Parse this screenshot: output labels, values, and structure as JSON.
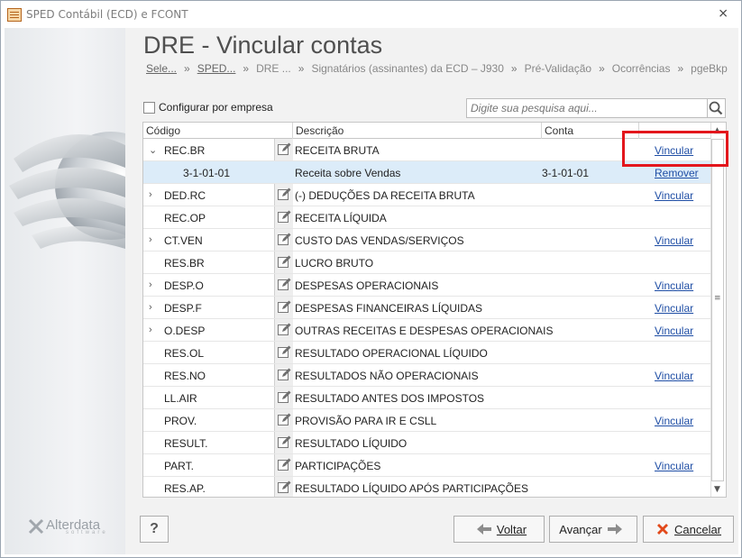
{
  "window": {
    "title": "SPED Contábil (ECD) e FCONT",
    "close_glyph": "⨯"
  },
  "page": {
    "title": "DRE - Vincular contas"
  },
  "breadcrumb": [
    {
      "label": "Sele...",
      "underline": true
    },
    {
      "label": "SPED...",
      "underline": true
    },
    {
      "label": "DRE ...",
      "underline": false
    },
    {
      "label": "Signatários (assinantes) da ECD – J930",
      "underline": false
    },
    {
      "label": "Pré-Validação",
      "underline": false
    },
    {
      "label": "Ocorrências",
      "underline": false
    },
    {
      "label": "pgeBkp",
      "underline": false
    }
  ],
  "breadcrumb_separator": "»",
  "config": {
    "checkbox_label": "Configurar por empresa",
    "checked": false
  },
  "search": {
    "placeholder": "Digite sua pesquisa aqui..."
  },
  "grid": {
    "headers": {
      "codigo": "Código",
      "descricao": "Descrição",
      "conta": "Conta"
    },
    "rows": [
      {
        "expander": "⌄",
        "code": "REC.BR",
        "desc": "RECEITA BRUTA",
        "conta": "",
        "action": "Vincular",
        "type": "parent-expanded"
      },
      {
        "expander": "",
        "code": "3-1-01-01",
        "desc": "Receita sobre Vendas",
        "conta": "3-1-01-01",
        "action": "Remover",
        "type": "child"
      },
      {
        "expander": "›",
        "code": "DED.RC",
        "desc": "(-) DEDUÇÕES DA RECEITA BRUTA",
        "conta": "",
        "action": "Vincular",
        "type": "parent"
      },
      {
        "expander": "",
        "code": "REC.OP",
        "desc": "RECEITA LÍQUIDA",
        "conta": "",
        "action": "",
        "type": "leaf"
      },
      {
        "expander": "›",
        "code": "CT.VEN",
        "desc": "CUSTO DAS VENDAS/SERVIÇOS",
        "conta": "",
        "action": "Vincular",
        "type": "parent"
      },
      {
        "expander": "",
        "code": "RES.BR",
        "desc": "LUCRO BRUTO",
        "conta": "",
        "action": "",
        "type": "leaf"
      },
      {
        "expander": "›",
        "code": "DESP.O",
        "desc": "DESPESAS OPERACIONAIS",
        "conta": "",
        "action": "Vincular",
        "type": "parent"
      },
      {
        "expander": "›",
        "code": "DESP.F",
        "desc": "DESPESAS FINANCEIRAS LÍQUIDAS",
        "conta": "",
        "action": "Vincular",
        "type": "parent"
      },
      {
        "expander": "›",
        "code": "O.DESP",
        "desc": "OUTRAS RECEITAS E DESPESAS OPERACIONAIS",
        "conta": "",
        "action": "Vincular",
        "type": "parent"
      },
      {
        "expander": "",
        "code": "RES.OL",
        "desc": "RESULTADO OPERACIONAL LÍQUIDO",
        "conta": "",
        "action": "",
        "type": "leaf"
      },
      {
        "expander": "",
        "code": "RES.NO",
        "desc": "RESULTADOS NÃO OPERACIONAIS",
        "conta": "",
        "action": "Vincular",
        "type": "leaf"
      },
      {
        "expander": "",
        "code": "LL.AIR",
        "desc": "RESULTADO ANTES DOS IMPOSTOS",
        "conta": "",
        "action": "",
        "type": "leaf"
      },
      {
        "expander": "",
        "code": "PROV.",
        "desc": "PROVISÃO PARA IR E CSLL",
        "conta": "",
        "action": "Vincular",
        "type": "leaf"
      },
      {
        "expander": "",
        "code": "RESULT.",
        "desc": "RESULTADO LÍQUIDO",
        "conta": "",
        "action": "",
        "type": "leaf"
      },
      {
        "expander": "",
        "code": "PART.",
        "desc": "PARTICIPAÇÕES",
        "conta": "",
        "action": "Vincular",
        "type": "leaf"
      },
      {
        "expander": "",
        "code": "RES.AP.",
        "desc": "RESULTADO LÍQUIDO APÓS PARTICIPAÇÕES",
        "conta": "",
        "action": "",
        "type": "leaf"
      }
    ]
  },
  "footer": {
    "help_label": "?",
    "back_label": "Voltar",
    "next_label": "Avançar",
    "cancel_label": "Cancelar"
  },
  "brand": {
    "name": "Alterdata",
    "sub": "software"
  },
  "colors": {
    "link": "#1f4ea5",
    "selected_row": "#dcecf9",
    "highlight": "#e3161c",
    "cancel_icon": "#e2491b",
    "arrow_gray": "#8c8c8c"
  }
}
